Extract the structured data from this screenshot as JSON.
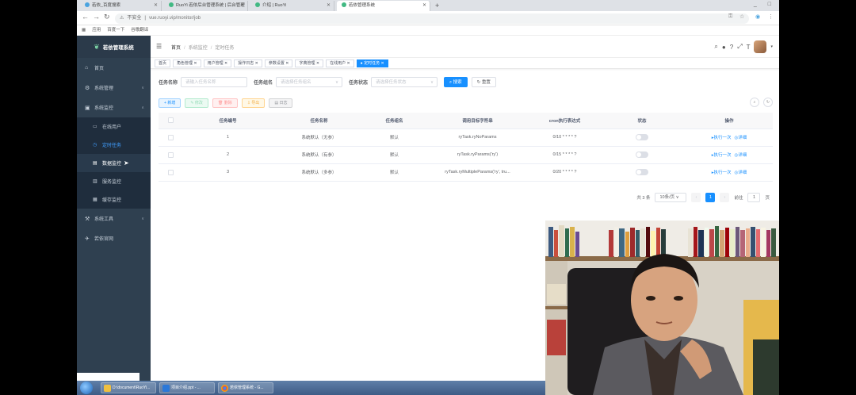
{
  "browser": {
    "tabs": [
      {
        "label": "若依_百度搜索"
      },
      {
        "label": "RuoYi 若依后台管理系统 | 后台管理"
      },
      {
        "label": "介绍 | RuoYi"
      },
      {
        "label": "若依管理系统",
        "active": true
      }
    ],
    "address": {
      "insecure_label": "不安全",
      "url": "vue.ruoyi.vip/monitor/job"
    },
    "bookmarks": [
      "应用",
      "百度一下",
      "谷歌翻译"
    ]
  },
  "sidebar": {
    "title": "若依管理系统",
    "items": [
      {
        "label": "首页",
        "icon": "dashboard-icon"
      },
      {
        "label": "系统管理",
        "icon": "gear-icon",
        "expandable": true
      },
      {
        "label": "系统监控",
        "icon": "monitor-icon",
        "expandable": true,
        "open": true
      },
      {
        "label": "系统工具",
        "icon": "tool-icon",
        "expandable": true
      },
      {
        "label": "若依官网",
        "icon": "guide-icon"
      }
    ],
    "submenu": [
      {
        "label": "在线用户",
        "icon": "online-icon"
      },
      {
        "label": "定时任务",
        "icon": "job-icon",
        "active": true
      },
      {
        "label": "数据监控",
        "icon": "druid-icon",
        "hover": true
      },
      {
        "label": "服务监控",
        "icon": "server-icon"
      },
      {
        "label": "缓存监控",
        "icon": "redis-icon"
      }
    ]
  },
  "navbar": {
    "breadcrumb": [
      "首页",
      "系统监控",
      "定时任务"
    ]
  },
  "tags": [
    {
      "label": "首页"
    },
    {
      "label": "角色管理"
    },
    {
      "label": "用户管理"
    },
    {
      "label": "操作日志"
    },
    {
      "label": "参数设置"
    },
    {
      "label": "字典管理"
    },
    {
      "label": "在线用户"
    },
    {
      "label": "定时任务",
      "active": true
    }
  ],
  "search": {
    "name_label": "任务名称",
    "name_placeholder": "请输入任务名称",
    "group_label": "任务组名",
    "group_placeholder": "请选择任务组名",
    "status_label": "任务状态",
    "status_placeholder": "请选择任务状态",
    "search_button": "搜索",
    "reset_button": "重置"
  },
  "toolbar": {
    "add": "新增",
    "edit": "修改",
    "delete": "删除",
    "export": "导出",
    "log": "日志"
  },
  "table": {
    "headers": [
      "任务编号",
      "任务名称",
      "任务组名",
      "调用目标字符串",
      "cron执行表达式",
      "状态",
      "操作"
    ],
    "rows": [
      {
        "id": "1",
        "name": "系统默认（无参）",
        "group": "默认",
        "target": "ryTask.ryNoParams",
        "cron": "0/10 * * * * ?"
      },
      {
        "id": "2",
        "name": "系统默认（有参）",
        "group": "默认",
        "target": "ryTask.ryParams('ry')",
        "cron": "0/15 * * * * ?"
      },
      {
        "id": "3",
        "name": "系统默认（多参）",
        "group": "默认",
        "target": "ryTask.ryMultipleParams('ry', tru...",
        "cron": "0/20 * * * * ?"
      }
    ],
    "op_run": "执行一次",
    "op_detail": "详细"
  },
  "pager": {
    "total": "共 3 条",
    "page_size": "10条/页",
    "current_page": "1",
    "goto_label": "前往",
    "goto_value": "1",
    "page_unit": "页"
  },
  "taskbar": {
    "tasks": [
      {
        "label": "D:\\document\\RuoYi..."
      },
      {
        "label": "项目介绍.ppt - ..."
      },
      {
        "label": "若依管理系统 - G..."
      }
    ]
  }
}
